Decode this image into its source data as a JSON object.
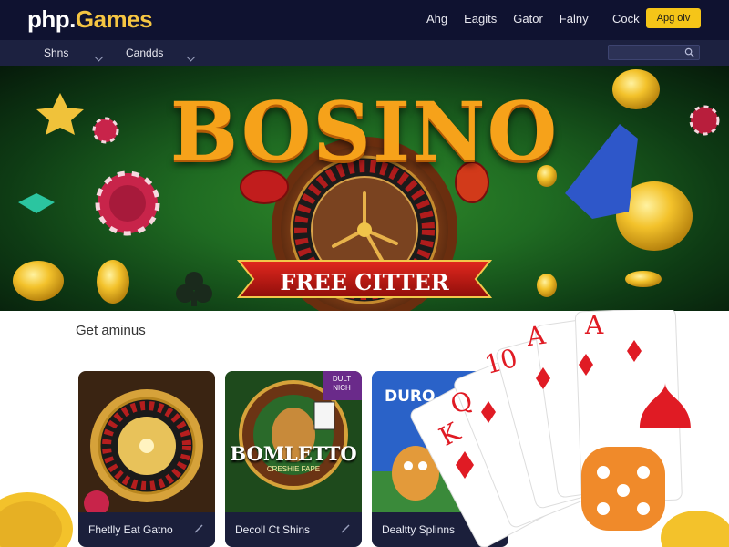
{
  "header": {
    "logo_php": "php.",
    "logo_games": "Games",
    "nav": [
      "Ahg",
      "Eagits",
      "Gator",
      "Falny"
    ],
    "cook": "Cock",
    "app_button": "Apg olv"
  },
  "subnav": {
    "items": [
      "Shns",
      "Candds"
    ],
    "search_placeholder": ""
  },
  "banner": {
    "title": "BOSINO",
    "ribbon": "FREE CITTER"
  },
  "section": {
    "title": "Get aminus"
  },
  "cards": [
    {
      "label": "Fhetlly Eat Gatno",
      "art_text": ""
    },
    {
      "label": "Decoll Ct Shins",
      "art_text": "BOMLETTO",
      "art_subtext": "CRESHIE FAPE",
      "badge": "DULT\nNICH"
    },
    {
      "label": "Dealtty Splinns",
      "art_text": "DURO"
    }
  ],
  "cards_art": {
    "playing_cards": [
      "K",
      "Q",
      "10",
      "A",
      "A"
    ]
  },
  "colors": {
    "nav_bg": "#0f1230",
    "subnav_bg": "#1c2140",
    "accent": "#f5c518",
    "card_footer": "#1b1f3b"
  }
}
